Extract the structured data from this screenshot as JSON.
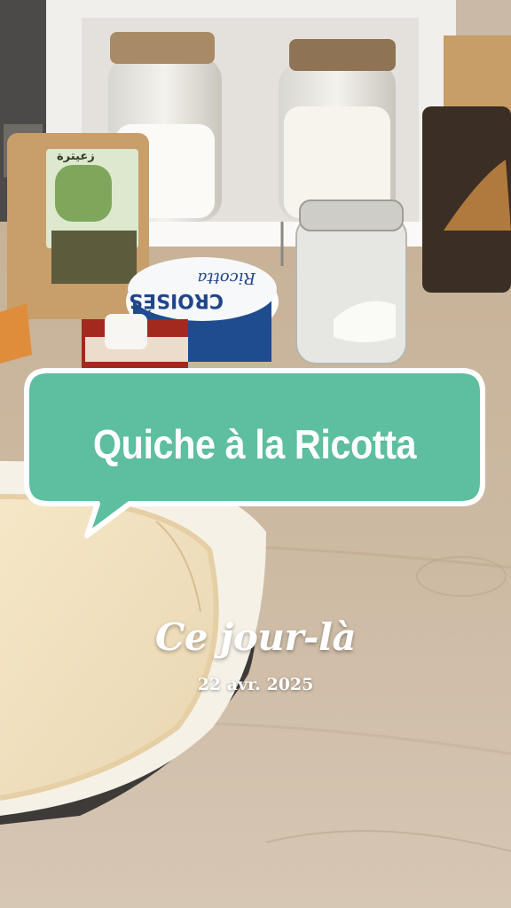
{
  "overlay": {
    "bubble_title": "Quiche à la Ricotta",
    "memory_title": "Ce jour-là",
    "memory_date": "22 avr. 2025"
  },
  "products": {
    "spice_pouch_label": "زعيترة",
    "ricotta_brand": "CROISÉS",
    "ricotta_label": "Ricotta"
  },
  "colors": {
    "bubble": "#5dbf9f",
    "bubble_border": "#ffffff",
    "text": "#ffffff"
  }
}
